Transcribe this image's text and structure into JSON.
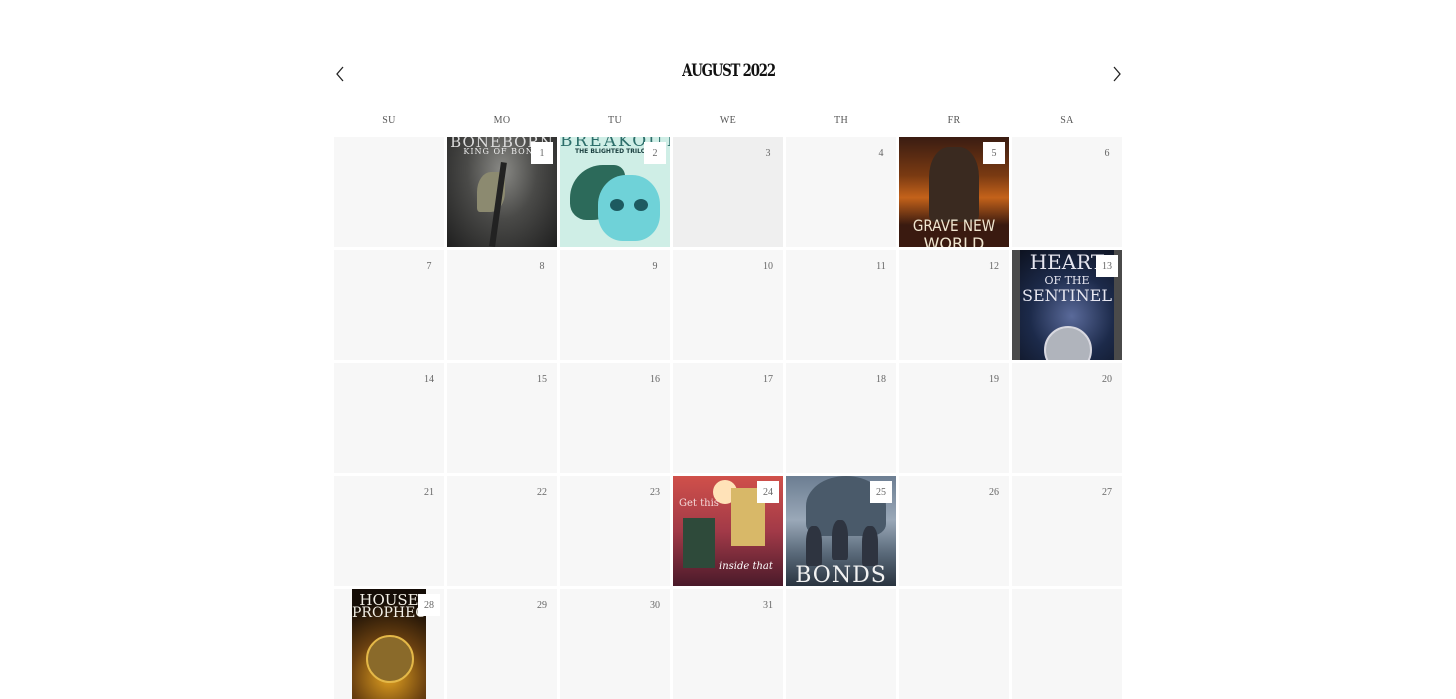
{
  "calendar": {
    "title": "AUGUST 2022",
    "prev_label": "Previous month",
    "next_label": "Next month",
    "weekdays": [
      "SU",
      "MO",
      "TU",
      "WE",
      "TH",
      "FR",
      "SA"
    ],
    "today": "3",
    "weeks": [
      [
        {
          "day": ""
        },
        {
          "day": "1",
          "cover": "Bone",
          "cover_title": "BONEBORN",
          "cover_subtitle": "KING OF BONE"
        },
        {
          "day": "2",
          "cover": "Skull",
          "cover_title": "BREAKOUT",
          "cover_subtitle": "THE BLIGHTED TRILOGY"
        },
        {
          "day": "3"
        },
        {
          "day": "4"
        },
        {
          "day": "5",
          "cover": "Grave",
          "cover_title": "GRAVE NEW",
          "cover_subtitle": "WORLD"
        },
        {
          "day": "6"
        }
      ],
      [
        {
          "day": "7"
        },
        {
          "day": "8"
        },
        {
          "day": "9"
        },
        {
          "day": "10"
        },
        {
          "day": "11"
        },
        {
          "day": "12"
        },
        {
          "day": "13",
          "cover": "Heart",
          "cover_title": "HEART",
          "cover_subtitle": "OF THE",
          "cover_subtitle2": "SENTINEL"
        }
      ],
      [
        {
          "day": "14"
        },
        {
          "day": "15"
        },
        {
          "day": "16"
        },
        {
          "day": "17"
        },
        {
          "day": "18"
        },
        {
          "day": "19"
        },
        {
          "day": "20"
        }
      ],
      [
        {
          "day": "21"
        },
        {
          "day": "22"
        },
        {
          "day": "23"
        },
        {
          "day": "24",
          "cover": "Get",
          "cover_title": "Get this",
          "cover_subtitle": "inside that"
        },
        {
          "day": "25",
          "cover": "Bonds",
          "cover_title": "BONDS"
        },
        {
          "day": "26"
        },
        {
          "day": "27"
        }
      ],
      [
        {
          "day": "28",
          "cover": "House",
          "cover_title": "HOUSE",
          "cover_subtitle": "PROPHECY"
        },
        {
          "day": "29"
        },
        {
          "day": "30"
        },
        {
          "day": "31"
        },
        {
          "day": ""
        },
        {
          "day": ""
        },
        {
          "day": ""
        }
      ]
    ]
  }
}
